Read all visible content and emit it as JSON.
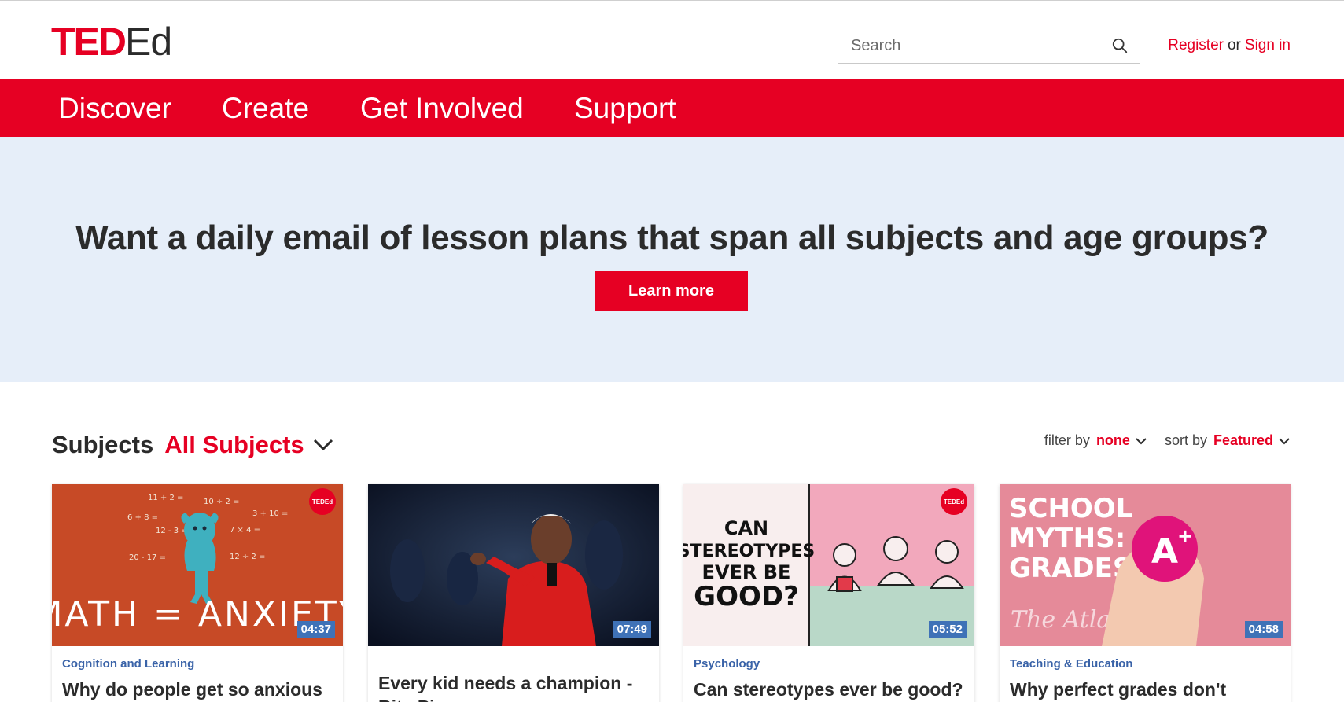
{
  "header": {
    "logo_ted": "TED",
    "logo_ed": "Ed",
    "search_placeholder": "Search",
    "register_label": "Register",
    "or_label": "or",
    "signin_label": "Sign in"
  },
  "nav": {
    "items": [
      "Discover",
      "Create",
      "Get Involved",
      "Support"
    ]
  },
  "hero": {
    "headline": "Want a daily email of lesson plans that span all subjects and age groups?",
    "button_label": "Learn more"
  },
  "subjects": {
    "label": "Subjects",
    "value": "All Subjects"
  },
  "controls": {
    "filter_label": "filter by",
    "filter_value": "none",
    "sort_label": "sort by",
    "sort_value": "Featured"
  },
  "cards": [
    {
      "category": "Cognition and Learning",
      "title": "Why do people get so anxious",
      "duration": "04:37",
      "thumb_text": "MATH = ANXIETY",
      "badge": "TEDEd"
    },
    {
      "category": "",
      "title": "Every kid needs a champion - Rita Pierson",
      "duration": "07:49"
    },
    {
      "category": "Psychology",
      "title": "Can stereotypes ever be good?",
      "duration": "05:52",
      "thumb_text": [
        "CAN",
        "STEREOTYPES",
        "EVER BE",
        "GOOD?"
      ],
      "badge": "TEDEd"
    },
    {
      "category": "Teaching & Education",
      "title": "Why perfect grades don't",
      "duration": "04:58",
      "thumb_text": [
        "SCHOOL",
        "MYTHS:",
        "GRADES"
      ],
      "brand": "The Atlantic"
    }
  ],
  "colors": {
    "brand_red": "#e60023",
    "hero_bg": "#e6eef9",
    "category_blue": "#3a63a8",
    "duration_bg": "#3f72b7"
  }
}
